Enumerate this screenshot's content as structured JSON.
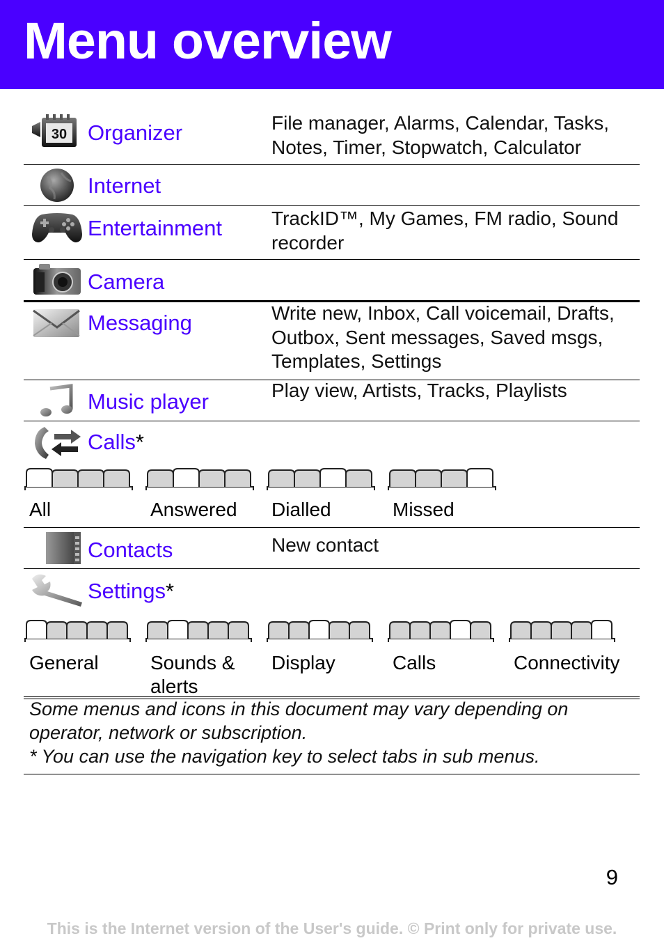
{
  "page": {
    "title": "Menu overview",
    "page_number": "9",
    "footer": "This is the Internet version of the User's guide. © Print only for private use."
  },
  "colors": {
    "brand": "#4a00ff",
    "tab_active_fill": "#ffffff",
    "tab_inactive_fill": "#d4d4d4",
    "footer_text": "#c8c8c8"
  },
  "menu": [
    {
      "label": "Organizer",
      "icon": "calendar-organizer-icon",
      "description": "File manager, Alarms, Calendar, Tasks, Notes, Timer, Stopwatch, Calculator"
    },
    {
      "label": "Internet",
      "icon": "globe-icon",
      "description": ""
    },
    {
      "label": "Entertainment",
      "icon": "gamepad-icon",
      "description": "TrackID™, My Games, FM radio, Sound recorder"
    },
    {
      "label": "Camera",
      "icon": "camera-icon",
      "description": ""
    },
    {
      "label": "Messaging",
      "icon": "envelope-icon",
      "description": "Write new, Inbox, Call voicemail, Drafts, Outbox, Sent messages, Saved msgs, Templates, Settings"
    },
    {
      "label": "Music player",
      "icon": "music-note-icon",
      "description": "Play view, Artists, Tracks, Playlists"
    },
    {
      "label": "Calls",
      "asterisk": "*",
      "icon": "phone-arrows-icon",
      "description": "",
      "tabs": [
        {
          "label": "All",
          "active_index": 0,
          "count": 4
        },
        {
          "label": "Answered",
          "active_index": 1,
          "count": 4
        },
        {
          "label": "Dialled",
          "active_index": 2,
          "count": 4
        },
        {
          "label": "Missed",
          "active_index": 3,
          "count": 4
        }
      ]
    },
    {
      "label": "Contacts",
      "icon": "contacts-book-icon",
      "description": "New contact"
    },
    {
      "label": "Settings",
      "asterisk": "*",
      "icon": "wrench-icon",
      "description": "",
      "tabs": [
        {
          "label": "General",
          "active_index": 0,
          "count": 5
        },
        {
          "label": "Sounds & alerts",
          "active_index": 1,
          "count": 5
        },
        {
          "label": "Display",
          "active_index": 2,
          "count": 5
        },
        {
          "label": "Calls",
          "active_index": 3,
          "count": 5
        },
        {
          "label": "Connectivity",
          "active_index": 4,
          "count": 5
        }
      ]
    }
  ],
  "notes": {
    "line1": "Some menus and icons in this document may vary depending on operator, network or subscription.",
    "line2": "* You can use the navigation key to select tabs in sub menus."
  }
}
